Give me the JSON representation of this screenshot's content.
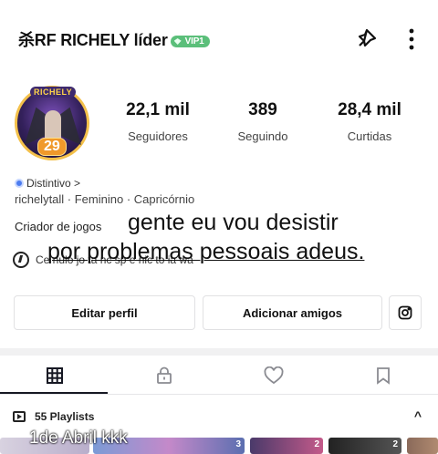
{
  "header": {
    "username": "杀RF RICHELY líder",
    "vip_label": "VIP1"
  },
  "avatar": {
    "name": "RICHELY",
    "level": "29"
  },
  "stats": [
    {
      "value": "22,1 mil",
      "label": "Seguidores"
    },
    {
      "value": "389",
      "label": "Seguindo"
    },
    {
      "value": "28,4 mil",
      "label": "Curtidas"
    }
  ],
  "profile": {
    "badge_label": "Distintivo >",
    "info_line": "richelytall · Feminino · Capricórnio",
    "bio": "Criador de jogos",
    "link_line": "Ce     nulo jo   ta        nc  sp         e    nic    to         ia    wa"
  },
  "overlay": {
    "line1": "gente eu vou desistir",
    "line2": "por problemas pessoais adeus.",
    "line3": "1de Abril kkk"
  },
  "buttons": {
    "edit": "Editar perfil",
    "add_friends": "Adicionar amigos"
  },
  "playlists": {
    "title": "55 Playlists",
    "counts": [
      "3",
      "2",
      "2"
    ]
  },
  "colors": {
    "vip": "#5bbf7a",
    "level_badge": "#f0992a",
    "avatar_ring": "#f3c04a",
    "badge_blue": "#4c7cf0"
  }
}
